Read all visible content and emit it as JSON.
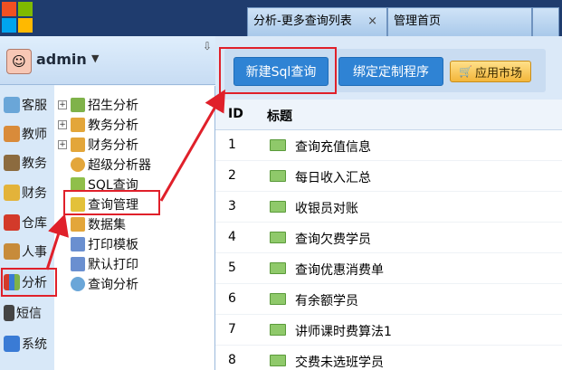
{
  "tabs": [
    {
      "label": "分析-更多查询列表",
      "close": "×"
    },
    {
      "label": "管理首页"
    },
    {
      "label": ""
    }
  ],
  "user": {
    "name": "admin",
    "caret": "▼",
    "pin": "⇩"
  },
  "sidebar": {
    "items": [
      {
        "label": "客服",
        "icon": "headset-icon",
        "color": "#6aa6d8"
      },
      {
        "label": "教师",
        "icon": "teacher-icon",
        "color": "#d98b3a"
      },
      {
        "label": "教务",
        "icon": "book-icon",
        "color": "#8c6b3f"
      },
      {
        "label": "财务",
        "icon": "coins-icon",
        "color": "#e3b33a"
      },
      {
        "label": "仓库",
        "icon": "warehouse-icon",
        "color": "#d33a2a"
      },
      {
        "label": "人事",
        "icon": "person-icon",
        "color": "#c78b3a"
      },
      {
        "label": "分析",
        "icon": "chart-icon",
        "color": "#3a7bd5"
      },
      {
        "label": "短信",
        "icon": "phone-icon",
        "color": "#444444"
      },
      {
        "label": "系统",
        "icon": "system-icon",
        "color": "#3a7bd5"
      }
    ]
  },
  "tree": {
    "items": [
      {
        "label": "招生分析",
        "expander": "+",
        "icon": "magnifier-chart-icon",
        "color": "#7fb24a"
      },
      {
        "label": "教务分析",
        "expander": "+",
        "icon": "magnifier-chart-icon",
        "color": "#e3a63a"
      },
      {
        "label": "财务分析",
        "expander": "+",
        "icon": "magnifier-chart-icon",
        "color": "#e3a63a"
      },
      {
        "label": "超级分析器",
        "expander": "",
        "icon": "magnifier-icon",
        "color": "#e3a63a"
      },
      {
        "label": "SQL查询",
        "expander": "",
        "icon": "sql-icon",
        "color": "#8fbf4a"
      },
      {
        "label": "查询管理",
        "expander": "",
        "icon": "sql-manage-icon",
        "color": "#e3c13a"
      },
      {
        "label": "数据集",
        "expander": "",
        "icon": "dataset-icon",
        "color": "#e3a63a"
      },
      {
        "label": "打印模板",
        "expander": "",
        "icon": "print-template-icon",
        "color": "#6a8fd0"
      },
      {
        "label": "默认打印",
        "expander": "",
        "icon": "print-icon",
        "color": "#6a8fd0"
      },
      {
        "label": "查询分析",
        "expander": "",
        "icon": "search-icon",
        "color": "#6aa6d8"
      }
    ]
  },
  "toolbar": {
    "new_sql": "新建Sql查询",
    "bind": "绑定定制程序",
    "market": "应用市场"
  },
  "table": {
    "headers": {
      "id": "ID",
      "title": "标题"
    },
    "rows": [
      {
        "id": "1",
        "title": "查询充值信息"
      },
      {
        "id": "2",
        "title": "每日收入汇总"
      },
      {
        "id": "3",
        "title": "收银员对账"
      },
      {
        "id": "4",
        "title": "查询欠费学员"
      },
      {
        "id": "5",
        "title": "查询优惠消费单"
      },
      {
        "id": "6",
        "title": "有余额学员"
      },
      {
        "id": "7",
        "title": "讲师课时费算法1"
      },
      {
        "id": "8",
        "title": "交费未选班学员"
      }
    ]
  }
}
